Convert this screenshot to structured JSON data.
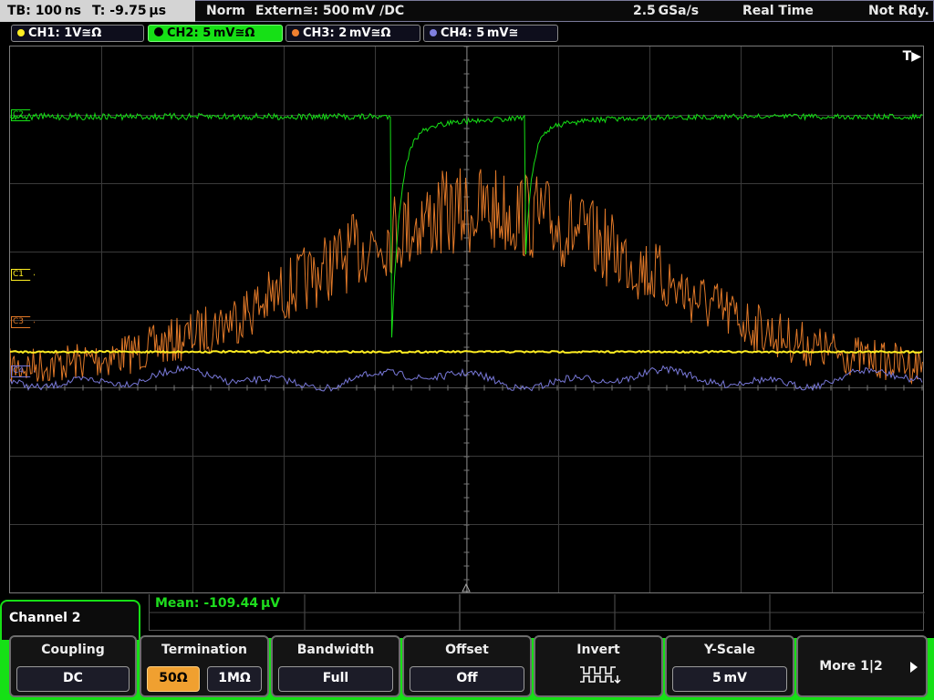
{
  "top": {
    "timebase": "TB: 100 ns",
    "trigger_time": "T: -9.75 µs",
    "mode": "Norm",
    "trigger": "Extern≅: 500 mV ∕DC",
    "sample_rate": "2.5 GSa/s",
    "acq": "Real Time",
    "status": "Not Rdy."
  },
  "channels": [
    {
      "label": "CH1: 1V≅Ω",
      "color": "#ffee22"
    },
    {
      "label": "CH2: 5 mV≅Ω",
      "color": "#16e016"
    },
    {
      "label": "CH3: 2 mV≅Ω",
      "color": "#f08030"
    },
    {
      "label": "CH4: 5 mV≅",
      "color": "#8080e0"
    }
  ],
  "markers": {
    "c1": "C1",
    "c3": "C3",
    "c4": "C4",
    "c2": "C2",
    "trigger": "T▶"
  },
  "measurement": "Mean: -109.44 µV",
  "menu": {
    "title": "Channel 2",
    "keys": [
      {
        "title": "Coupling",
        "value": "DC"
      },
      {
        "title": "Termination",
        "value_a": "50Ω",
        "value_b": "1MΩ"
      },
      {
        "title": "Bandwidth",
        "value": "Full"
      },
      {
        "title": "Offset",
        "value": "Off"
      },
      {
        "title": "Invert",
        "icon": "invert-waveform-icon"
      },
      {
        "title": "Y-Scale",
        "value": "5 mV"
      },
      {
        "title": "More 1|2",
        "icon": "arrow-right-icon"
      }
    ]
  },
  "colors": {
    "ch1": "#ffee22",
    "ch2": "#16e016",
    "ch3": "#e07828",
    "ch4": "#7878d8",
    "grid": "#3a3a3a",
    "accent": "#16e016"
  }
}
